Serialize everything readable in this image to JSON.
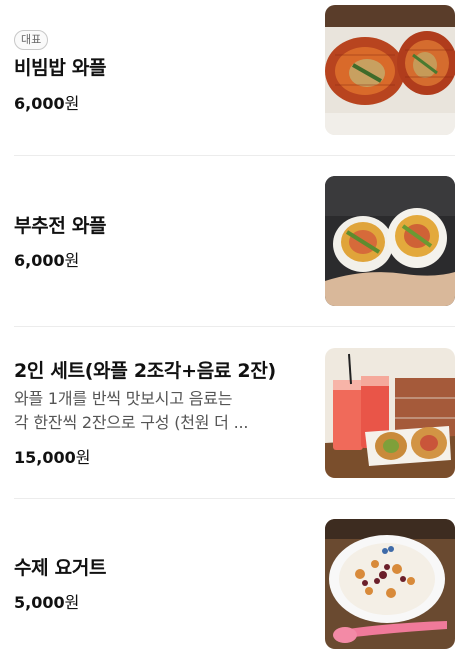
{
  "menu": {
    "items": [
      {
        "badge": "대표",
        "name": "비빔밥 와플",
        "price_num": "6,000",
        "price_unit": "원",
        "image": "bibimbap-waffle-photo"
      },
      {
        "name": "부추전 와플",
        "price_num": "6,000",
        "price_unit": "원",
        "image": "chive-pancake-waffle-photo"
      },
      {
        "name": "2인 세트(와플 2조각+음료 2잔)",
        "desc_line1": "와플 1개를 반씩 맛보시고 음료는",
        "desc_line2": "각 한잔씩 2잔으로 구성 (천원 더 ...",
        "price_num": "15,000",
        "price_unit": "원",
        "image": "two-person-set-photo"
      },
      {
        "name": "수제 요거트",
        "price_num": "5,000",
        "price_unit": "원",
        "image": "homemade-yogurt-photo"
      }
    ]
  }
}
